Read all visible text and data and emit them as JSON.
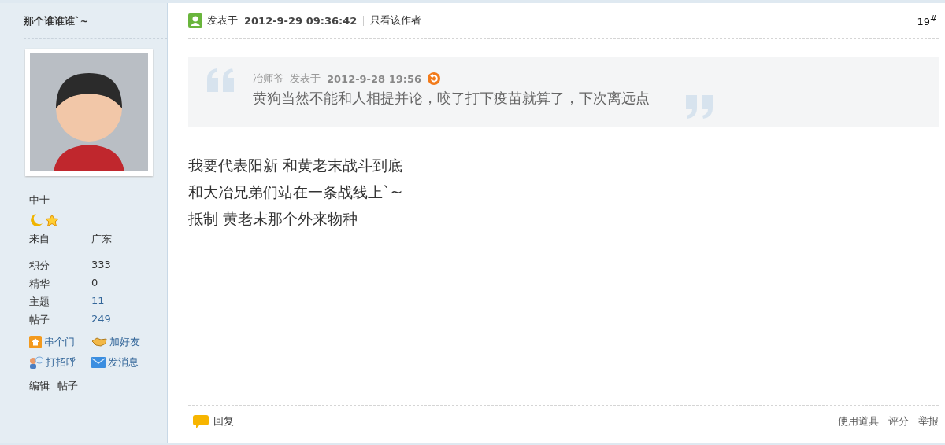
{
  "author": {
    "name": "那个谁谁谁`~",
    "rank": "中士"
  },
  "profile": [
    {
      "label": "来自",
      "value": "广东",
      "link": false
    },
    {
      "label": "积分",
      "value": "333",
      "link": false
    },
    {
      "label": "精华",
      "value": "0",
      "link": false
    },
    {
      "label": "主题",
      "value": "11",
      "link": true
    },
    {
      "label": "帖子",
      "value": "249",
      "link": true
    }
  ],
  "actions": [
    {
      "kind": "home",
      "label": "串个门"
    },
    {
      "kind": "friend",
      "label": "加好友"
    },
    {
      "kind": "greet",
      "label": "打招呼"
    },
    {
      "kind": "message",
      "label": "发消息"
    }
  ],
  "admin_links": [
    "编辑",
    "帖子"
  ],
  "post": {
    "posted_label": "发表于",
    "posted_time": "2012-9-29 09:36:42",
    "author_only": "只看该作者",
    "floor": "19",
    "floor_mark": "#",
    "quote": {
      "author": "冶师爷",
      "posted_label": "发表于",
      "time": "2012-9-28 19:56",
      "text": "黄狗当然不能和人相提并论，咬了打下疫苗就算了，下次离远点"
    },
    "lines": [
      "我要代表阳新  和黄老末战斗到底",
      "和大冶兄弟们站在一条战线上`~",
      "抵制  黄老末那个外来物种"
    ]
  },
  "footer": {
    "reply": "回复",
    "tools": [
      "使用道具",
      "评分",
      "举报"
    ]
  }
}
